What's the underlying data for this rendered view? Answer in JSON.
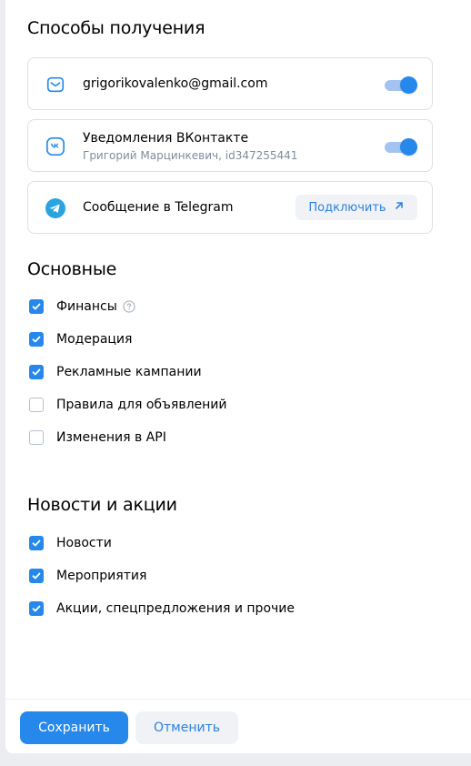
{
  "delivery": {
    "title": "Способы получения",
    "email": {
      "label": "grigorikovalenko@gmail.com",
      "enabled": true,
      "icon": "mail-icon"
    },
    "vk": {
      "label": "Уведомления ВКонтакте",
      "sublabel": "Григорий Марцинкевич, id347255441",
      "enabled": true,
      "icon": "vk-icon"
    },
    "telegram": {
      "label": "Сообщение в Telegram",
      "connect_label": "Подключить",
      "icon": "telegram-icon"
    }
  },
  "main": {
    "title": "Основные",
    "items": [
      {
        "label": "Финансы",
        "checked": true,
        "help": true
      },
      {
        "label": "Модерация",
        "checked": true
      },
      {
        "label": "Рекламные кампании",
        "checked": true
      },
      {
        "label": "Правила для объявлений",
        "checked": false
      },
      {
        "label": "Изменения в API",
        "checked": false
      }
    ]
  },
  "news": {
    "title": "Новости и акции",
    "items": [
      {
        "label": "Новости",
        "checked": true
      },
      {
        "label": "Мероприятия",
        "checked": true
      },
      {
        "label": "Акции, спецпредложения и прочие",
        "checked": true
      }
    ]
  },
  "footer": {
    "save_label": "Сохранить",
    "cancel_label": "Отменить"
  },
  "colors": {
    "accent": "#2688eb",
    "link": "#2d81e0",
    "secondary_text": "#818c99",
    "border": "#dce1e6"
  }
}
